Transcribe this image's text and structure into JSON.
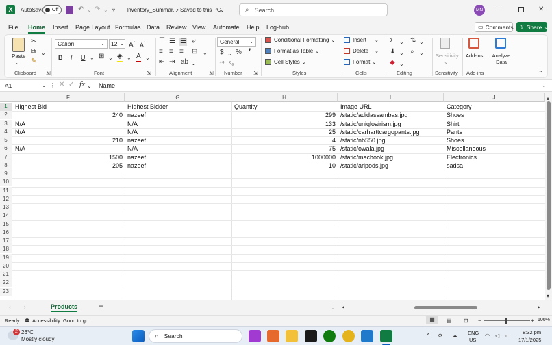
{
  "titlebar": {
    "autosave_label": "AutoSave",
    "autosave_state": "Off",
    "filename": "Inventory_Summar...",
    "saved_status": "• Saved to this PC",
    "search_placeholder": "Search",
    "user_initials": "MN"
  },
  "tabs": [
    "File",
    "Home",
    "Insert",
    "Page Layout",
    "Formulas",
    "Data",
    "Review",
    "View",
    "Automate",
    "Help",
    "Log-hub"
  ],
  "active_tab": "Home",
  "comments_label": "Comments",
  "share_label": "Share",
  "ribbon": {
    "clipboard": {
      "paste_label": "Paste",
      "group_label": "Clipboard"
    },
    "font": {
      "font_name": "Calibri",
      "font_size": "12",
      "group_label": "Font"
    },
    "alignment": {
      "group_label": "Alignment"
    },
    "number": {
      "format": "General",
      "group_label": "Number"
    },
    "styles": {
      "conditional": "Conditional Formatting",
      "format_table": "Format as Table",
      "cell_styles": "Cell Styles",
      "group_label": "Styles"
    },
    "cells": {
      "insert": "Insert",
      "delete": "Delete",
      "format": "Format",
      "group_label": "Cells"
    },
    "editing": {
      "group_label": "Editing"
    },
    "sensitivity": {
      "label": "Sensitivity",
      "group_label": "Sensitivity"
    },
    "addins": {
      "label": "Add-ins",
      "group_label": "Add-ins"
    },
    "analyze": {
      "label": "Analyze Data"
    }
  },
  "formula_bar": {
    "name_box": "A1",
    "fx": "fx",
    "content": "Name"
  },
  "columns": [
    "F",
    "G",
    "H",
    "I",
    "J"
  ],
  "rows": [
    "1",
    "2",
    "3",
    "4",
    "5",
    "6",
    "7",
    "8",
    "9",
    "10",
    "11",
    "12",
    "13",
    "14",
    "15",
    "16",
    "17",
    "18",
    "19",
    "20",
    "21",
    "22",
    "23"
  ],
  "table": {
    "headers": [
      "Highest Bid",
      "Highest Bidder",
      "Quantity",
      "Image URL",
      "Category"
    ],
    "rows": [
      [
        "240",
        "nazeef",
        "299",
        "/static/adidassambas.jpg",
        "Shoes"
      ],
      [
        "N/A",
        "N/A",
        "133",
        "/static/uniqloairism.jpg",
        "Shirt"
      ],
      [
        "N/A",
        "N/A",
        "25",
        "/static/carharttcargopants.jpg",
        "Pants"
      ],
      [
        "210",
        "nazeef",
        "4",
        "/static/nb550.jpg",
        "Shoes"
      ],
      [
        "N/A",
        "N/A",
        "75",
        "/static/owala.jpg",
        "Miscellaneous"
      ],
      [
        "1500",
        "nazeef",
        "1000000",
        "/static/macbook.jpg",
        "Electronics"
      ],
      [
        "205",
        "nazeef",
        "10",
        "/static/aripods.jpg",
        "sadsa"
      ]
    ]
  },
  "sheet_tab": "Products",
  "status": {
    "ready": "Ready",
    "accessibility": "Accessibility: Good to go",
    "zoom": "100%"
  },
  "taskbar": {
    "weather_temp": "26°C",
    "weather_desc": "Mostly cloudy",
    "weather_badge": "2",
    "search_label": "Search",
    "lang": "ENG",
    "region": "US",
    "time": "8:32 pm",
    "date": "17/1/2025"
  },
  "colors": {
    "excel_green": "#107c41",
    "accent": "#217346",
    "share_green": "#107c41"
  }
}
